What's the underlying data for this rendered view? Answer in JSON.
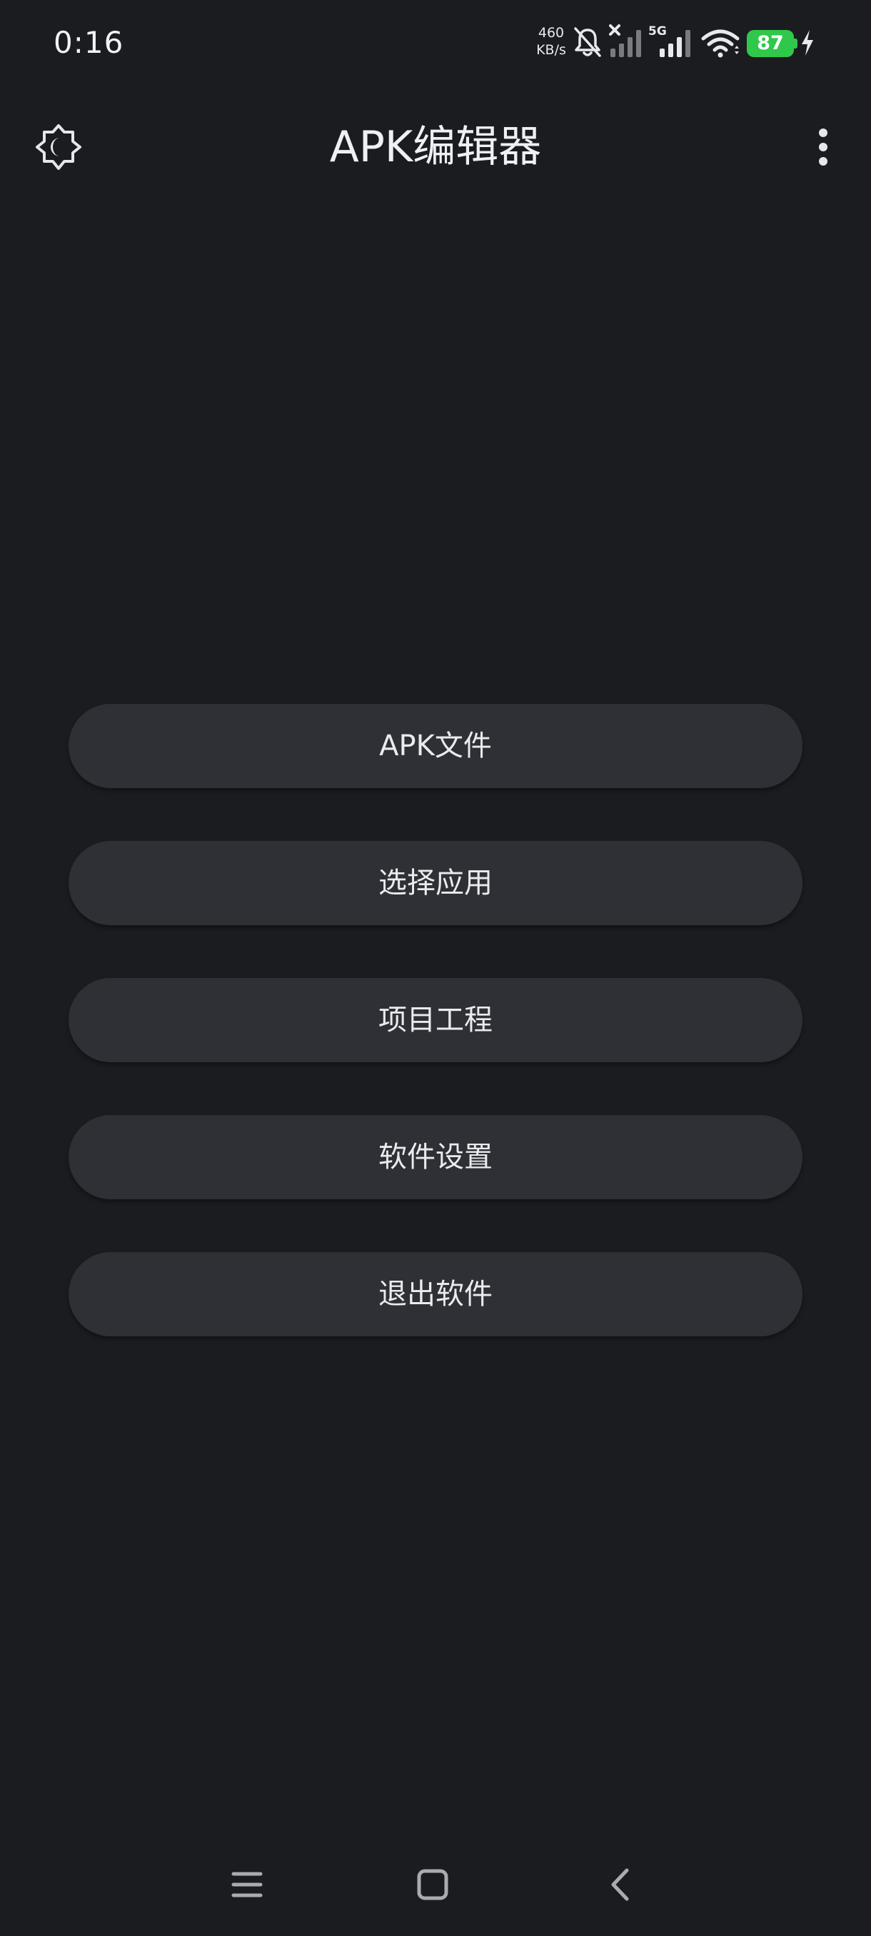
{
  "status_bar": {
    "time": "0:16",
    "net_speed_value": "460",
    "net_speed_unit": "KB/s",
    "network_type": "5G",
    "battery_level": "87",
    "battery_color": "#2fc84a",
    "icons": [
      "bell-off-icon",
      "signal-x-icon",
      "signal-5g-icon",
      "wifi-icon",
      "charging-icon"
    ]
  },
  "app_bar": {
    "title": "APK编辑器",
    "left_icon": "theme-toggle-icon",
    "right_icon": "more-vert-icon"
  },
  "menu": {
    "items": [
      {
        "label": "APK文件"
      },
      {
        "label": "选择应用"
      },
      {
        "label": "项目工程"
      },
      {
        "label": "软件设置"
      },
      {
        "label": "退出软件"
      }
    ]
  },
  "nav_bar": {
    "icons": [
      "menu-icon",
      "home-icon",
      "back-icon"
    ]
  },
  "colors": {
    "background": "#1b1c20",
    "button": "#2f3035",
    "text": "#e9ebef"
  }
}
